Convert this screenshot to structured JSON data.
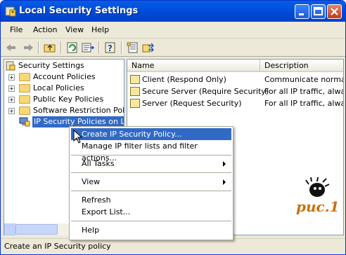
{
  "window": {
    "title": "Local Security Settings"
  },
  "menubar": {
    "items": [
      "File",
      "Action",
      "View",
      "Help"
    ]
  },
  "toolbar": {
    "icons": [
      "back-icon",
      "forward-icon",
      "up-folder-icon",
      "refresh-icon",
      "export-list-icon",
      "help-icon",
      "properties-icon",
      "assign-icon"
    ]
  },
  "tree": {
    "root": "Security Settings",
    "items": [
      {
        "label": "Account Policies",
        "expander": "+"
      },
      {
        "label": "Local Policies",
        "expander": "+"
      },
      {
        "label": "Public Key Policies",
        "expander": "+"
      },
      {
        "label": "Software Restriction Policies",
        "expander": "+"
      },
      {
        "label": "IP Security Policies on Local Computer",
        "expander": ""
      }
    ]
  },
  "list": {
    "columns": [
      "Name",
      "Description"
    ],
    "rows": [
      {
        "name": "Client (Respond Only)",
        "description": "Communicate normally (unsecured)."
      },
      {
        "name": "Secure Server (Require Security)",
        "description": "For all IP traffic, always require"
      },
      {
        "name": "Server (Request Security)",
        "description": "For all IP traffic, always request"
      }
    ]
  },
  "context_menu": {
    "items": [
      {
        "label": "Create IP Security Policy...",
        "highlighted": true
      },
      {
        "label": "Manage IP filter lists and filter actions..."
      },
      {
        "label": "All Tasks",
        "submenu": true
      },
      {
        "label": "View",
        "submenu": true
      },
      {
        "label": "Refresh"
      },
      {
        "label": "Export List..."
      },
      {
        "label": "Help"
      }
    ]
  },
  "status": {
    "text": "Create an IP Security policy"
  },
  "watermark": {
    "text": "puc.1"
  },
  "colors": {
    "title_blue": "#0054e3",
    "highlight": "#316ac5",
    "face": "#ece9d8"
  }
}
